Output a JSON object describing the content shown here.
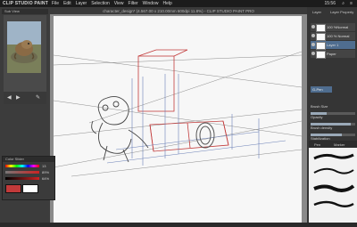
{
  "menubar": {
    "app_name": "CLIP STUDIO PAINT",
    "items": [
      "File",
      "Edit",
      "Layer",
      "Selection",
      "View",
      "Filter",
      "Window",
      "Help"
    ],
    "clock": "15:56"
  },
  "document": {
    "title": "character_design* (4.567.00 x 210.00mm 600dpi 11.8%) - CLIP STUDIO PAINT PRO"
  },
  "subview": {
    "tab_label": "Sub View"
  },
  "color_mixer": {
    "title": "Color Slider",
    "values": [
      "13",
      "89%",
      "64%"
    ]
  },
  "layers": {
    "tabs": [
      "Layer",
      "Layer Property"
    ],
    "rows": [
      {
        "name": "100 %Normal"
      },
      {
        "name": "100 % Normal"
      },
      {
        "name": "Layer 1"
      },
      {
        "name": "Paper"
      }
    ]
  },
  "tool_property": {
    "tab_label": "G-Pen",
    "properties": [
      {
        "label": "Brush Size",
        "fraction": 0.35
      },
      {
        "label": "Opacity",
        "fraction": 0.9
      },
      {
        "label": "Brush density",
        "fraction": 0.7
      },
      {
        "label": "Stabilization",
        "fraction": 0.4
      }
    ]
  },
  "brush": {
    "tabs": [
      "Pen",
      "Marker"
    ]
  },
  "colors": {
    "accent": "#4f6d8f",
    "perspective_red": "#c23a3a",
    "sketch_blue": "#6a7fb6"
  }
}
